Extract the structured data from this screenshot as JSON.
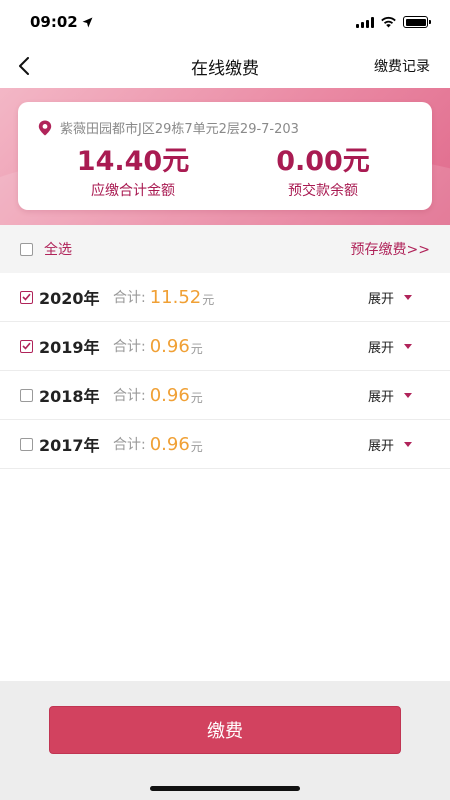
{
  "status_bar": {
    "time": "09:02"
  },
  "nav": {
    "title": "在线缴费",
    "right_link": "缴费记录"
  },
  "summary": {
    "address": "紫薇田园都市J区29栋7单元2层29-7-203",
    "amount_due": {
      "value": "14.40元",
      "label": "应缴合计金额"
    },
    "prepaid_balance": {
      "value": "0.00元",
      "label": "预交款余额"
    }
  },
  "select_bar": {
    "select_all_label": "全选",
    "prestore_link": "预存缴费>>"
  },
  "years": [
    {
      "year": "2020年",
      "checked": true,
      "total_label": "合计:",
      "total_value": "11.52",
      "unit": "元",
      "expand_label": "展开"
    },
    {
      "year": "2019年",
      "checked": true,
      "total_label": "合计:",
      "total_value": "0.96",
      "unit": "元",
      "expand_label": "展开"
    },
    {
      "year": "2018年",
      "checked": false,
      "total_label": "合计:",
      "total_value": "0.96",
      "unit": "元",
      "expand_label": "展开"
    },
    {
      "year": "2017年",
      "checked": false,
      "total_label": "合计:",
      "total_value": "0.96",
      "unit": "元",
      "expand_label": "展开"
    }
  ],
  "footer": {
    "pay_button_label": "缴费"
  },
  "colors": {
    "accent": "#b0245a",
    "amount": "#f0a035",
    "button": "#d2425f",
    "hero": "#ea8aa4"
  }
}
